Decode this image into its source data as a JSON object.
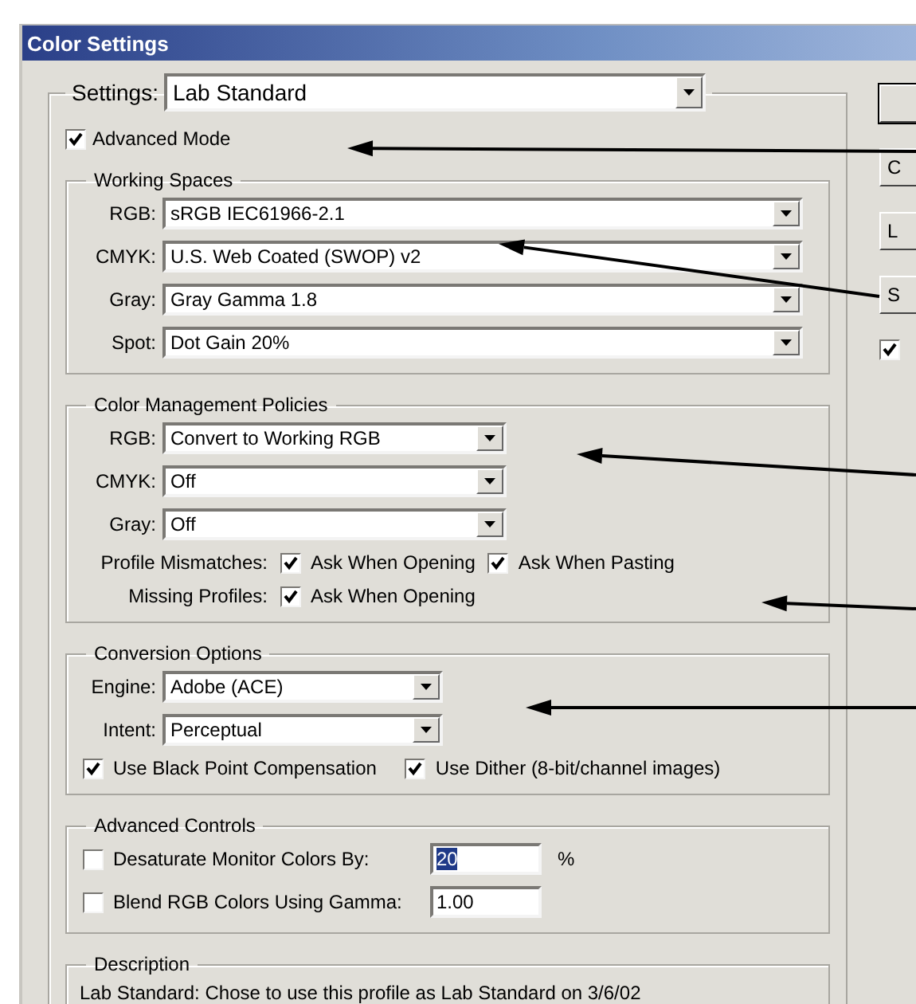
{
  "window": {
    "title": "Color Settings"
  },
  "settings": {
    "label": "Settings:",
    "value": "Lab Standard"
  },
  "advanced_mode": {
    "label": "Advanced Mode",
    "checked": true
  },
  "working_spaces": {
    "title": "Working Spaces",
    "fields": [
      {
        "label": "RGB:",
        "value": "sRGB IEC61966-2.1"
      },
      {
        "label": "CMYK:",
        "value": "U.S. Web Coated (SWOP) v2"
      },
      {
        "label": "Gray:",
        "value": "Gray Gamma 1.8"
      },
      {
        "label": "Spot:",
        "value": "Dot Gain 20%"
      }
    ]
  },
  "color_management_policies": {
    "title": "Color Management Policies",
    "fields": [
      {
        "label": "RGB:",
        "value": "Convert to Working RGB"
      },
      {
        "label": "CMYK:",
        "value": "Off"
      },
      {
        "label": "Gray:",
        "value": "Off"
      }
    ],
    "checks": [
      {
        "label": "Profile Mismatches:",
        "options": [
          {
            "label": "Ask When Opening",
            "checked": true
          },
          {
            "label": "Ask When Pasting",
            "checked": true
          }
        ]
      },
      {
        "label": "Missing Profiles:",
        "options": [
          {
            "label": "Ask When Opening",
            "checked": true
          }
        ]
      }
    ]
  },
  "conversion_options": {
    "title": "Conversion Options",
    "fields": [
      {
        "label": "Engine:",
        "value": "Adobe (ACE)"
      },
      {
        "label": "Intent:",
        "value": "Perceptual"
      }
    ],
    "options": [
      {
        "label": "Use Black Point Compensation",
        "checked": true
      },
      {
        "label": "Use Dither (8-bit/channel images)",
        "checked": true
      }
    ]
  },
  "advanced_controls": {
    "title": "Advanced Controls",
    "rows": [
      {
        "label": "Desaturate Monitor Colors By:",
        "checked": false,
        "value": "20",
        "highlighted": true,
        "unit": "%"
      },
      {
        "label": "Blend RGB Colors Using Gamma:",
        "checked": false,
        "value": "1.00",
        "highlighted": false
      }
    ]
  },
  "description": {
    "title": "Description",
    "text": "Lab Standard:  Chose to use this profile as Lab Standard on 3/6/02"
  },
  "side_buttons": [
    {
      "kind": "blank"
    },
    {
      "kind": "text",
      "label": "C"
    },
    {
      "kind": "text",
      "label": "L"
    },
    {
      "kind": "text",
      "label": "S"
    }
  ],
  "side_checkbox": {
    "checked": true
  }
}
